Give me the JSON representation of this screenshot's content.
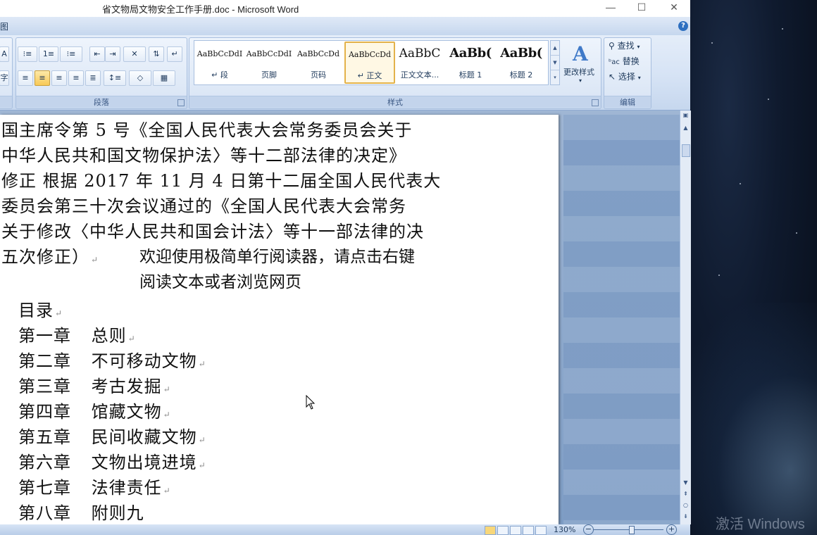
{
  "window": {
    "title": "省文物局文物安全工作手册.doc - Microsoft Word",
    "controls": {
      "minimize": "—",
      "maximize": "☐",
      "close": "✕"
    }
  },
  "tabstrip": {
    "fragment": "图",
    "help": "?"
  },
  "ribbon": {
    "paragraph_group": {
      "label": "段落",
      "buttons": [
        "bullets",
        "numbering",
        "multilevel-list",
        "decrease-indent",
        "increase-indent",
        "chinese-layout",
        "sort",
        "show-marks",
        "align-left",
        "center",
        "align-right",
        "justify",
        "distributed",
        "line-spacing",
        "shading",
        "borders"
      ]
    },
    "styles_group": {
      "label": "样式",
      "items": [
        {
          "sample": "AaBbCcDdI",
          "name": "↵ 段"
        },
        {
          "sample": "AaBbCcDdI",
          "name": "页脚"
        },
        {
          "sample": "AaBbCcDd",
          "name": "页码"
        },
        {
          "sample": "AaBbCcDd",
          "name": "↵ 正文"
        },
        {
          "sample": "AaBbC",
          "name": "正文文本..."
        },
        {
          "sample": "AaBb(",
          "name": "标题 1"
        },
        {
          "sample": "AaBb(",
          "name": "标题 2"
        }
      ],
      "change_styles": "更改样式"
    },
    "editing_group": {
      "label": "编辑",
      "find": "查找",
      "replace": "替换",
      "select": "选择"
    }
  },
  "document": {
    "lines": [
      "国主席令第 5 号《全国人民代表大会常务委员会关于",
      "中华人民共和国文物保护法〉等十二部法律的决定》",
      "修正  根据 2017 年 11 月 4 日第十二届全国人民代表大",
      "委员会第三十次会议通过的《全国人民代表大会常务",
      "关于修改〈中华人民共和国会计法〉等十一部法律的决",
      "五次修正）"
    ],
    "overlay": [
      "欢迎使用极简单行阅读器，请点击右键",
      "阅读文本或者浏览网页"
    ],
    "toc_title": "目录",
    "chapters": [
      {
        "num": "第一章",
        "title": "总则"
      },
      {
        "num": "第二章",
        "title": "不可移动文物"
      },
      {
        "num": "第三章",
        "title": "考古发掘"
      },
      {
        "num": "第四章",
        "title": "馆藏文物"
      },
      {
        "num": "第五章",
        "title": "民间收藏文物"
      },
      {
        "num": "第六章",
        "title": "文物出境进境"
      },
      {
        "num": "第七章",
        "title": "法律责任"
      },
      {
        "num": "第八章",
        "title": "附则九"
      }
    ]
  },
  "statusbar": {
    "zoom": "130%",
    "zoom_out": "−",
    "zoom_in": "+"
  },
  "desktop": {
    "watermark": "激活 Windows"
  },
  "colors": {
    "ribbon_bg": "#d6e3f5",
    "selected_style": "#e3b24a",
    "page_bg": "#ffffff"
  }
}
